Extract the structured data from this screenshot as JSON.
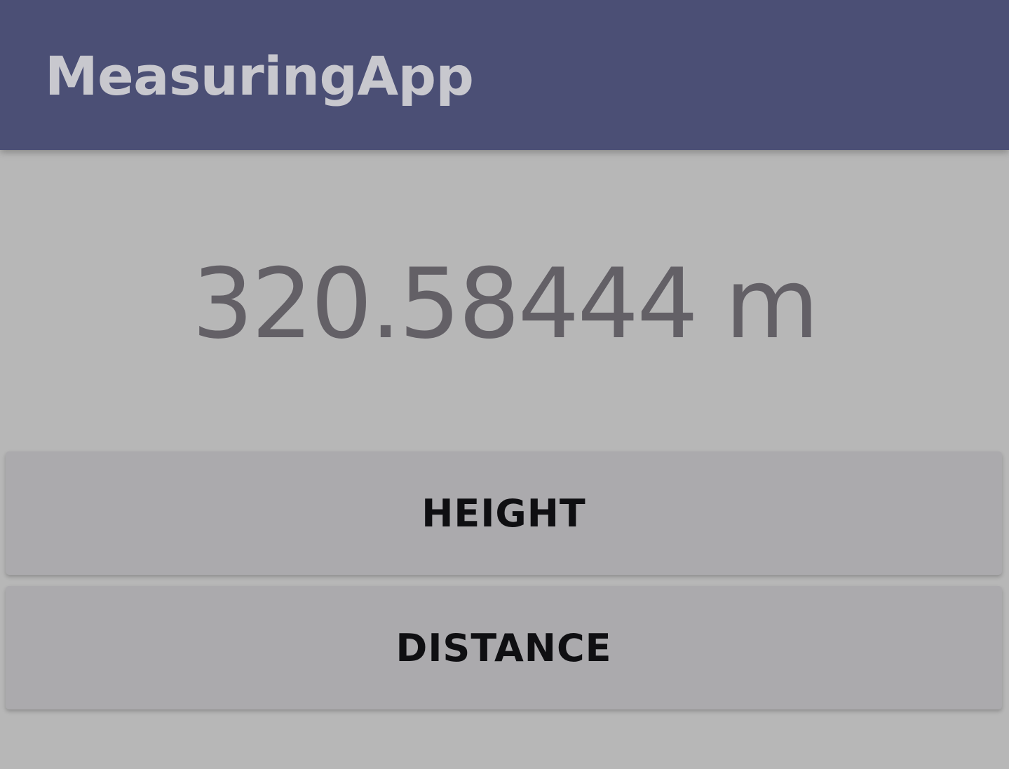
{
  "app_bar": {
    "title": "MeasuringApp",
    "background_color": "#4b4f75"
  },
  "display": {
    "value_text": "320.58444 m"
  },
  "buttons": {
    "height_label": "HEIGHT",
    "distance_label": "DISTANCE"
  }
}
